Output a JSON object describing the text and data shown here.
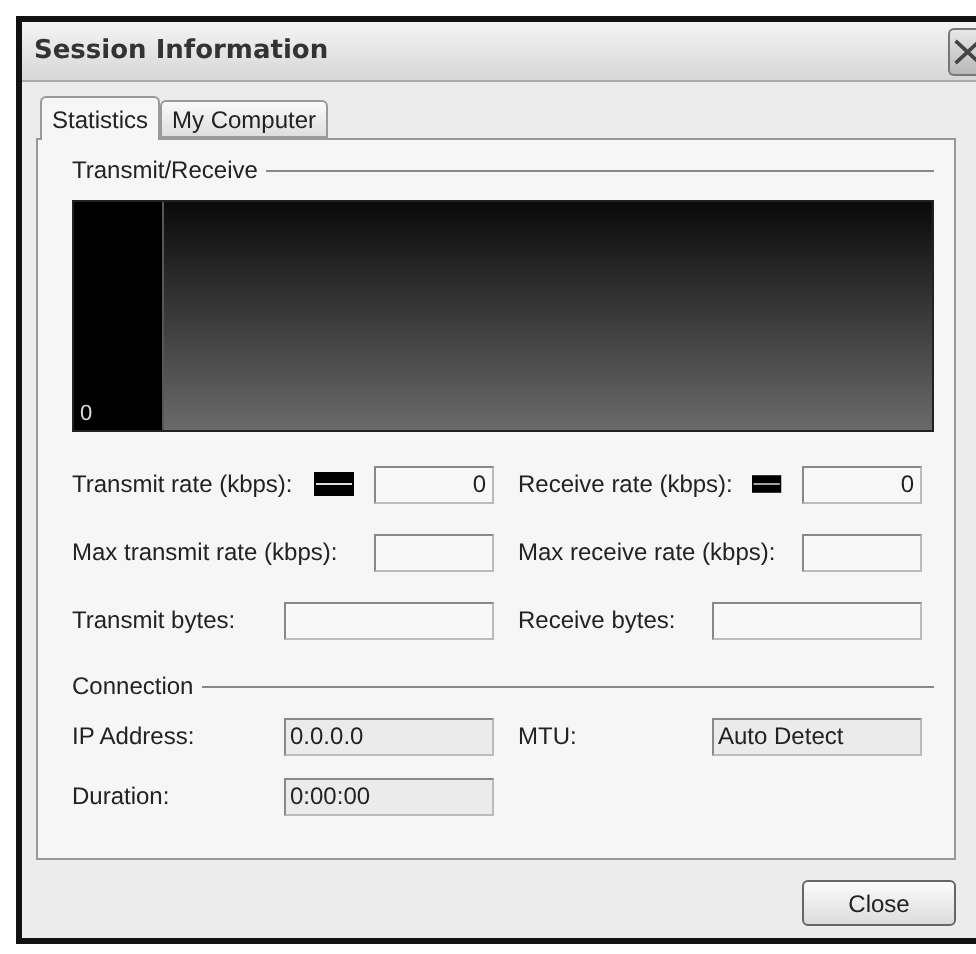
{
  "window": {
    "title": "Session Information"
  },
  "tabs": [
    {
      "label": "Statistics",
      "selected": true
    },
    {
      "label": "My Computer",
      "selected": false
    }
  ],
  "transmit_receive": {
    "heading": "Transmit/Receive",
    "graph_label": "0",
    "rows": [
      [
        {
          "label": "Transmit rate (kbps):",
          "swatch": true,
          "value": "0"
        },
        {
          "label": "Receive rate (kbps):",
          "swatch": true,
          "value": "0"
        }
      ],
      [
        {
          "label": "Max transmit rate (kbps):",
          "swatch": false
        },
        {
          "label": "Max receive rate (kbps):",
          "swatch": false
        }
      ],
      [
        {
          "label": "Transmit bytes:",
          "swatch": false
        },
        {
          "label": "Receive bytes:",
          "swatch": false
        }
      ]
    ]
  },
  "connection": {
    "heading": "Connection",
    "rows": [
      [
        {
          "label": "IP Address:",
          "value": "0.0.0.0"
        },
        {
          "label": "MTU:",
          "value": "Auto Detect"
        }
      ],
      [
        {
          "label": "Duration:",
          "value": "0:00:00"
        }
      ]
    ]
  },
  "buttons": [
    "Close"
  ]
}
